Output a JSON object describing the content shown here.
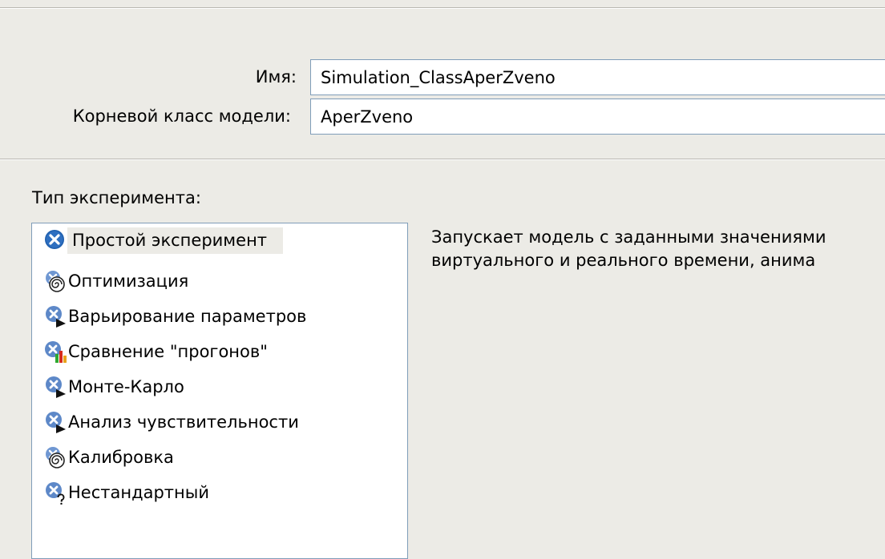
{
  "form": {
    "name_label": "Имя:",
    "name_value": "Simulation_ClassAperZveno",
    "root_class_label": "Корневой класс модели:",
    "root_class_value": "AperZveno"
  },
  "experiment_type": {
    "label": "Тип эксперимента:",
    "selected_index": 0,
    "items": [
      {
        "label": "Простой эксперимент",
        "icon": "simple-experiment-icon"
      },
      {
        "label": "Оптимизация",
        "icon": "optimization-icon"
      },
      {
        "label": "Варьирование параметров",
        "icon": "parameter-variation-icon"
      },
      {
        "label": "Сравнение \"прогонов\"",
        "icon": "compare-runs-icon"
      },
      {
        "label": "Монте-Карло",
        "icon": "monte-carlo-icon"
      },
      {
        "label": "Анализ чувствительности",
        "icon": "sensitivity-analysis-icon"
      },
      {
        "label": "Калибровка",
        "icon": "calibration-icon"
      },
      {
        "label": "Нестандартный",
        "icon": "custom-experiment-icon"
      }
    ]
  },
  "description": {
    "line1": "Запускает модель с заданными значениями",
    "line2": "виртуального и реального времени, анима"
  },
  "colors": {
    "background": "#ecebe6",
    "input_border": "#7f9db9",
    "icon_blue": "#1f5fae",
    "icon_light_blue": "#6f97d2"
  }
}
